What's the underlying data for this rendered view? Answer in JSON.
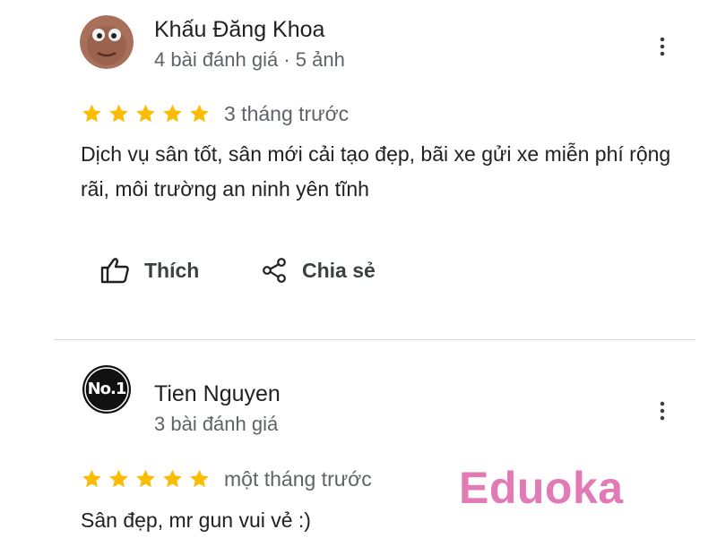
{
  "reviews": [
    {
      "author": "Khấu Đăng Khoa",
      "meta": "4 bài đánh giá · 5 ảnh",
      "rating": 5,
      "date": "3 tháng trước",
      "text": "Dịch vụ sân tốt, sân mới cải tạo đẹp, bãi xe gửi xe miễn phí rộng rãi, môi trường an ninh yên tĩnh",
      "actions": {
        "like_label": "Thích",
        "share_label": "Chia sẻ"
      },
      "avatar_icon": "round-character-avatar"
    },
    {
      "author": "Tien Nguyen",
      "meta": "3 bài đánh giá",
      "rating": 5,
      "date": "một tháng trước",
      "text": "Sân đẹp, mr gun vui vẻ :)",
      "avatar_icon": "no1-badge-avatar",
      "avatar_badge": "No.1"
    }
  ],
  "icons": {
    "star": "star-icon",
    "more": "more-vert-icon",
    "like": "thumb-up-icon",
    "share": "share-icon"
  },
  "colors": {
    "star": "#fbbc04",
    "primary_text": "#202124",
    "secondary_text": "#5f6368",
    "divider": "#dadce0",
    "watermark": "#e27ab5"
  },
  "watermark": "Eduoka"
}
